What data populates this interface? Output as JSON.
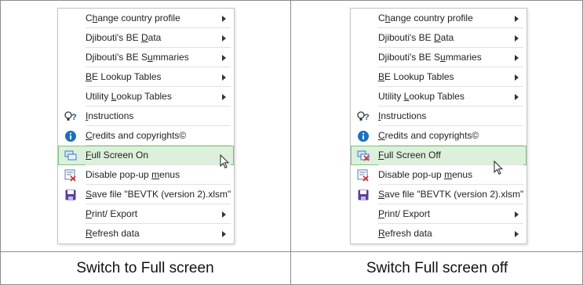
{
  "panels": [
    {
      "caption": "Switch to Full screen",
      "items": [
        {
          "pre": "C",
          "key": "h",
          "post": "ange country profile",
          "submenu": true,
          "icon": ""
        },
        {
          "pre": "Djibouti's BE ",
          "key": "D",
          "post": "ata",
          "submenu": true,
          "icon": ""
        },
        {
          "pre": "Djibouti's BE S",
          "key": "u",
          "post": "mmaries",
          "submenu": true,
          "icon": ""
        },
        {
          "pre": "",
          "key": "B",
          "post": "E Lookup Tables",
          "submenu": true,
          "icon": ""
        },
        {
          "pre": "Utility ",
          "key": "L",
          "post": "ookup Tables",
          "submenu": true,
          "icon": ""
        },
        {
          "pre": "",
          "key": "I",
          "post": "nstructions",
          "submenu": false,
          "icon": "help-icon"
        },
        {
          "pre": "",
          "key": "C",
          "post": "redits and copyrights©",
          "submenu": false,
          "icon": "info-icon"
        },
        {
          "pre": "",
          "key": "F",
          "post": "ull Screen On",
          "submenu": false,
          "icon": "full-screen-icon",
          "highlight": true
        },
        {
          "pre": "Disable pop-up ",
          "key": "m",
          "post": "enus",
          "submenu": false,
          "icon": "disable-menu-icon"
        },
        {
          "pre": "",
          "key": "S",
          "post": "ave file \"BEVTK (version 2).xlsm\"",
          "submenu": false,
          "icon": "save-icon"
        },
        {
          "pre": "",
          "key": "P",
          "post": "rint/ Export",
          "submenu": true,
          "icon": ""
        },
        {
          "pre": "",
          "key": "R",
          "post": "efresh data",
          "submenu": true,
          "icon": ""
        }
      ]
    },
    {
      "caption": "Switch Full screen off",
      "items": [
        {
          "pre": "C",
          "key": "h",
          "post": "ange country profile",
          "submenu": true,
          "icon": ""
        },
        {
          "pre": "Djibouti's BE ",
          "key": "D",
          "post": "ata",
          "submenu": true,
          "icon": ""
        },
        {
          "pre": "Djibouti's BE S",
          "key": "u",
          "post": "mmaries",
          "submenu": true,
          "icon": ""
        },
        {
          "pre": "",
          "key": "B",
          "post": "E Lookup Tables",
          "submenu": true,
          "icon": ""
        },
        {
          "pre": "Utility ",
          "key": "L",
          "post": "ookup Tables",
          "submenu": true,
          "icon": ""
        },
        {
          "pre": "",
          "key": "I",
          "post": "nstructions",
          "submenu": false,
          "icon": "help-icon"
        },
        {
          "pre": "",
          "key": "C",
          "post": "redits and copyrights©",
          "submenu": false,
          "icon": "info-icon"
        },
        {
          "pre": "",
          "key": "F",
          "post": "ull Screen Off",
          "submenu": false,
          "icon": "full-screen-off-icon",
          "highlight": true
        },
        {
          "pre": "Disable pop-up ",
          "key": "m",
          "post": "enus",
          "submenu": false,
          "icon": "disable-menu-icon"
        },
        {
          "pre": "",
          "key": "S",
          "post": "ave file \"BEVTK (version 2).xlsm\"",
          "submenu": false,
          "icon": "save-icon"
        },
        {
          "pre": "",
          "key": "P",
          "post": "rint/ Export",
          "submenu": true,
          "icon": ""
        },
        {
          "pre": "",
          "key": "R",
          "post": "efresh data",
          "submenu": true,
          "icon": ""
        }
      ]
    }
  ],
  "colors": {
    "highlight_bg": "#dcf0dc",
    "highlight_border": "#7fc47f",
    "info_blue": "#1f6fbf",
    "save_purple": "#5a3e9a"
  }
}
